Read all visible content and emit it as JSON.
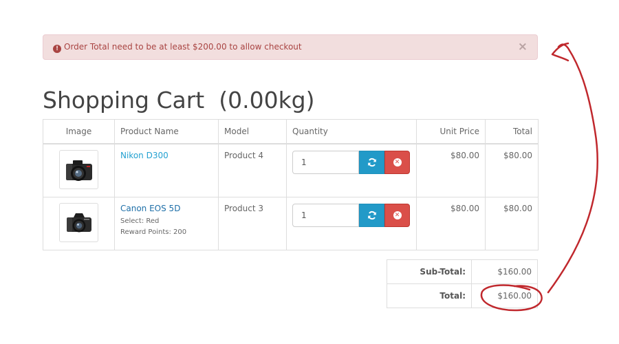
{
  "alert": {
    "message": "Order Total need to be at least $200.00 to allow checkout",
    "icon": "exclamation-circle-icon",
    "close": "×"
  },
  "page": {
    "title": "Shopping Cart  (0.00kg)"
  },
  "cart": {
    "headers": {
      "image": "Image",
      "name": "Product Name",
      "model": "Model",
      "quantity": "Quantity",
      "unit_price": "Unit Price",
      "total": "Total"
    },
    "rows": [
      {
        "name": "Nikon D300",
        "options": [],
        "model": "Product 4",
        "quantity": "1",
        "unit_price": "$80.00",
        "total": "$80.00",
        "image_icon": "nikon-camera-icon"
      },
      {
        "name": "Canon EOS 5D",
        "options": [
          "Select: Red",
          "Reward Points: 200"
        ],
        "model": "Product 3",
        "quantity": "1",
        "unit_price": "$80.00",
        "total": "$80.00",
        "image_icon": "canon-camera-icon"
      }
    ]
  },
  "totals": [
    {
      "label": "Sub-Total:",
      "value": "$160.00"
    },
    {
      "label": "Total:",
      "value": "$160.00"
    }
  ],
  "colors": {
    "alert_bg": "#f2dede",
    "alert_text": "#a94442",
    "link": "#23a1d1",
    "update_button": "#229ac8",
    "remove_button": "#da4f49",
    "annotation": "#c0282d"
  }
}
